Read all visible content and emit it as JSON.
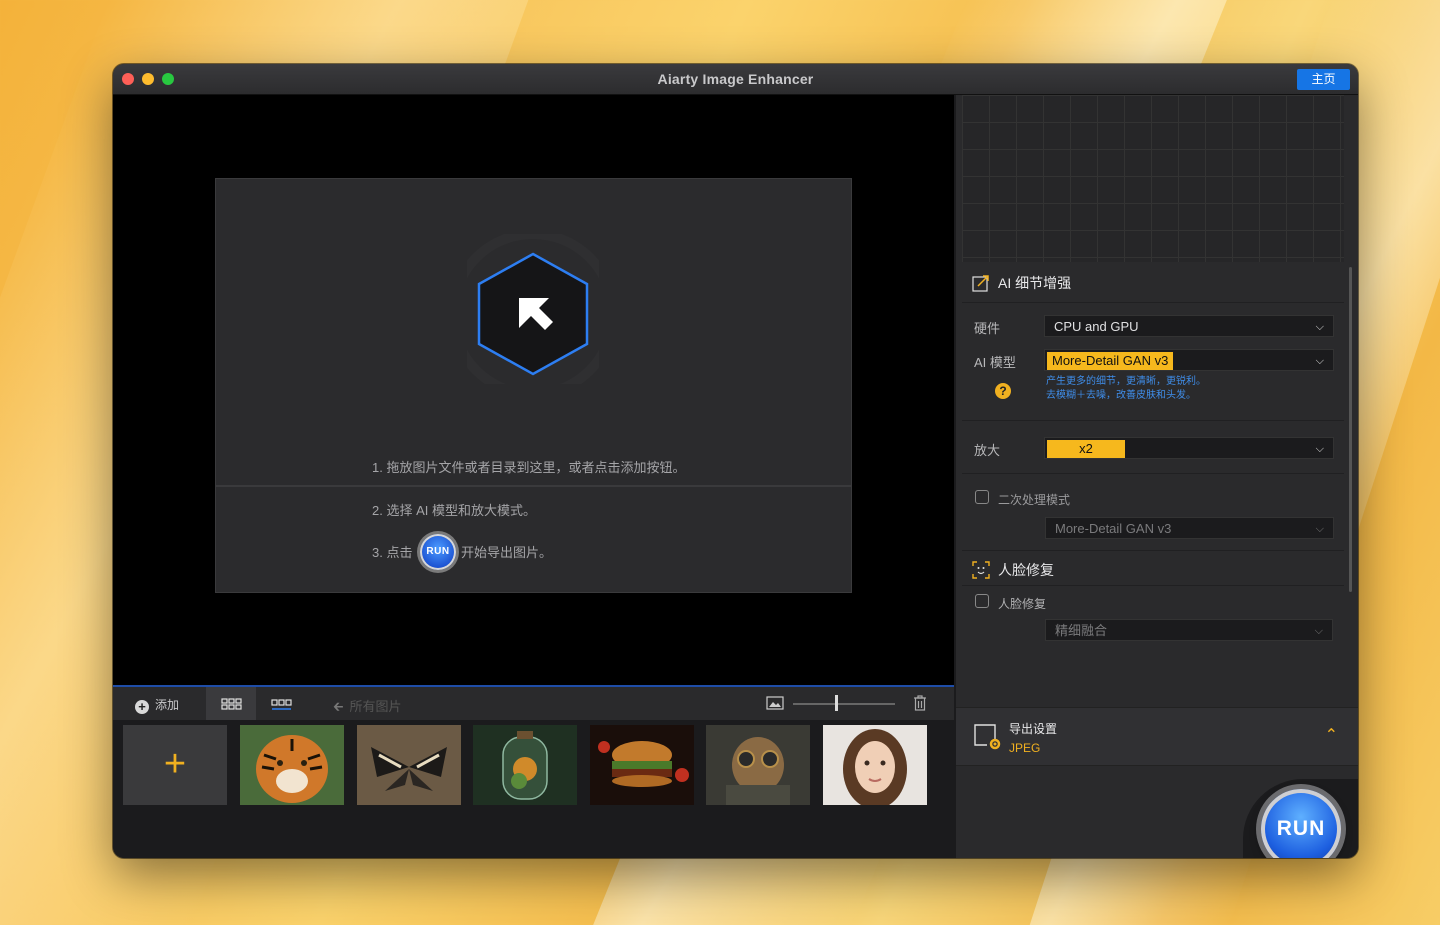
{
  "window": {
    "title": "Aiarty Image Enhancer",
    "home_button": "主页"
  },
  "instructions": {
    "step1": "1. 拖放图片文件或者目录到这里，或者点击添加按钮。",
    "step2": "2. 选择 AI 模型和放大模式。",
    "step3_prefix": "3. 点击",
    "step3_run": "RUN",
    "step3_suffix": "开始导出图片。"
  },
  "bottombar": {
    "add_label": "添加",
    "all_images": "所有图片"
  },
  "thumbnails": [
    "tiger",
    "butterfly",
    "terrarium",
    "burger",
    "steampunk-dog",
    "portrait"
  ],
  "panel": {
    "ai_section_title": "AI 细节增强",
    "hardware_label": "硬件",
    "hardware_value": "CPU and GPU",
    "model_label": "AI 模型",
    "model_value": "More-Detail GAN v3",
    "model_desc_line1": "产生更多的细节，更清晰，更锐利。",
    "model_desc_line2": "去模糊＋去噪，改善皮肤和头发。",
    "help_icon_text": "?",
    "scale_label": "放大",
    "scale_value": "x2",
    "second_pass_label": "二次处理模式",
    "second_pass_model": "More-Detail GAN v3",
    "face_section_title": "人脸修复",
    "face_checkbox_label": "人脸修复",
    "face_mode": "精细融合",
    "export_title": "导出设置",
    "export_format": "JPEG",
    "run_label": "RUN"
  },
  "colors": {
    "accent_blue": "#1675e5",
    "accent_yellow": "#f6b81d",
    "desc_blue": "#3f8de9"
  }
}
